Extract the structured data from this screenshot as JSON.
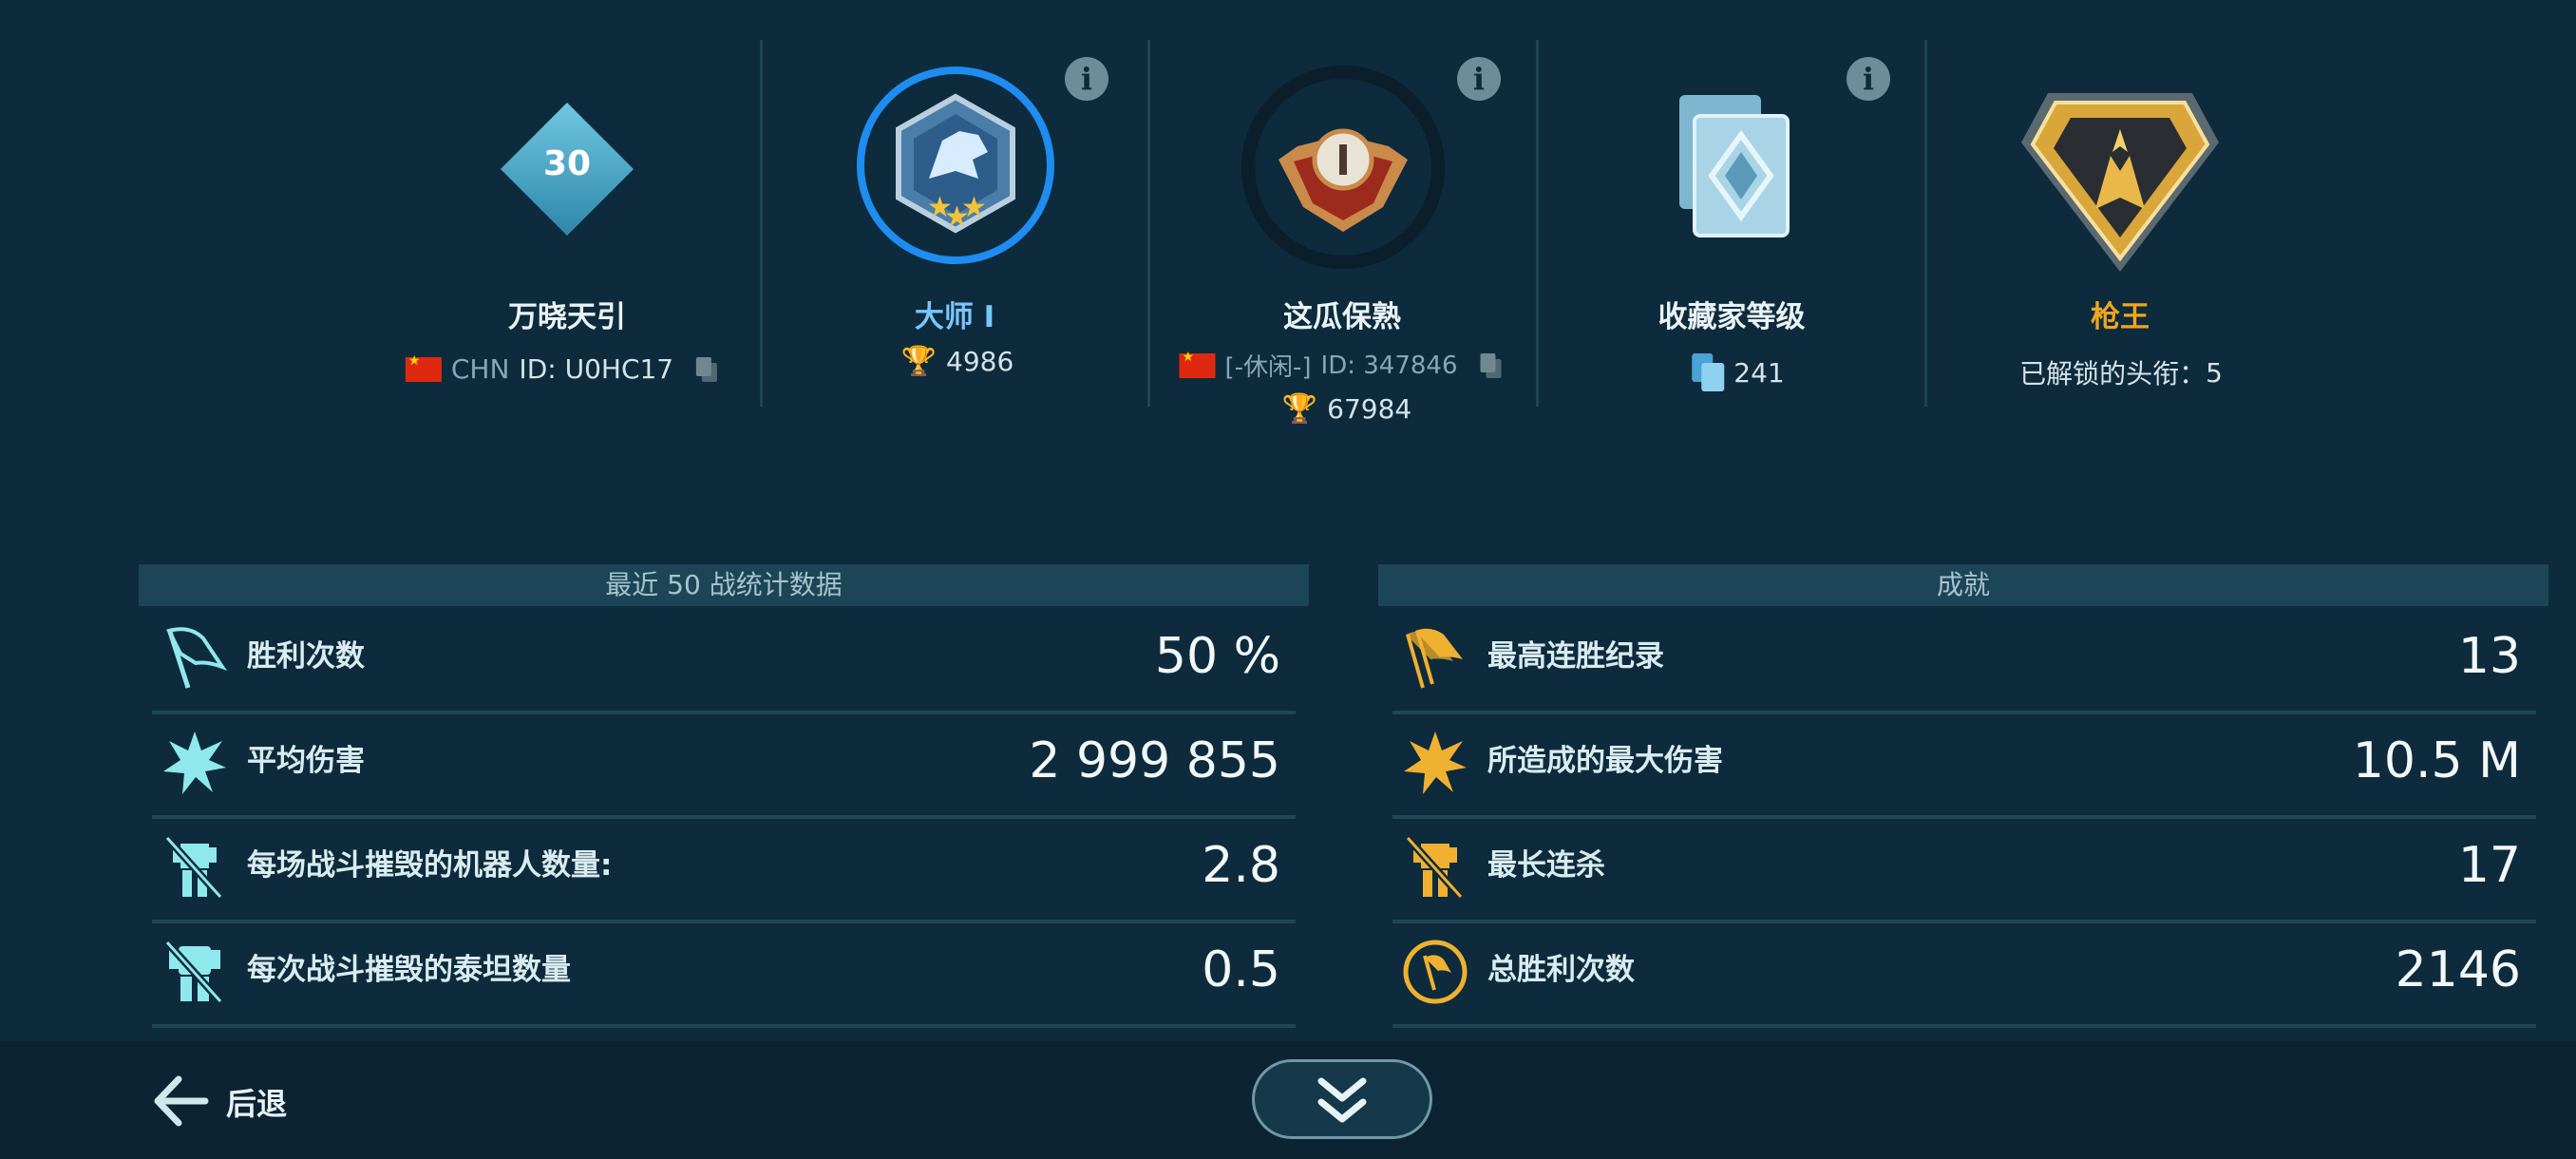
{
  "profile": {
    "level": "30",
    "name": "万晓天引",
    "country": "CHN",
    "id_text": "ID: U0HC17"
  },
  "league": {
    "name": "大师 I",
    "trophies": "4986"
  },
  "clan": {
    "name": "这瓜保熟",
    "tag": "[-休闲-]",
    "id_text": "ID: 347846",
    "trophies": "67984"
  },
  "collector": {
    "title": "收藏家等级",
    "value": "241"
  },
  "title_badge": {
    "name": "枪王",
    "unlocked_label": "已解锁的头衔：",
    "unlocked_count": "5"
  },
  "info_icon_glyph": "i",
  "recent_stats": {
    "header": "最近 50 战统计数据",
    "rows": [
      {
        "icon": "victory-flag-icon",
        "label": "胜利次数",
        "value": "50 %"
      },
      {
        "icon": "explosion-icon",
        "label": "平均伤害",
        "value": "2 999 855"
      },
      {
        "icon": "robot-destroyed-icon",
        "label": "每场战斗摧毁的机器人数量:",
        "value": "2.8"
      },
      {
        "icon": "titan-destroyed-icon",
        "label": "每次战斗摧毁的泰坦数量",
        "value": "0.5"
      }
    ]
  },
  "achievements": {
    "header": "成就",
    "rows": [
      {
        "icon": "win-streak-flags-icon",
        "label": "最高连胜纪录",
        "value": "13"
      },
      {
        "icon": "max-damage-icon",
        "label": "所造成的最大伤害",
        "value": "10.5 M"
      },
      {
        "icon": "kill-streak-icon",
        "label": "最长连杀",
        "value": "17"
      },
      {
        "icon": "total-wins-icon",
        "label": "总胜利次数",
        "value": "2146"
      }
    ]
  },
  "footer": {
    "back_label": "后退"
  },
  "colors": {
    "background": "#0d2b3c",
    "league_ring": "#1e8cf0",
    "gold_accent": "#f0a520",
    "stat_icon_cyan": "#8fe8ec",
    "achievement_icon_gold": "#f0b030"
  }
}
